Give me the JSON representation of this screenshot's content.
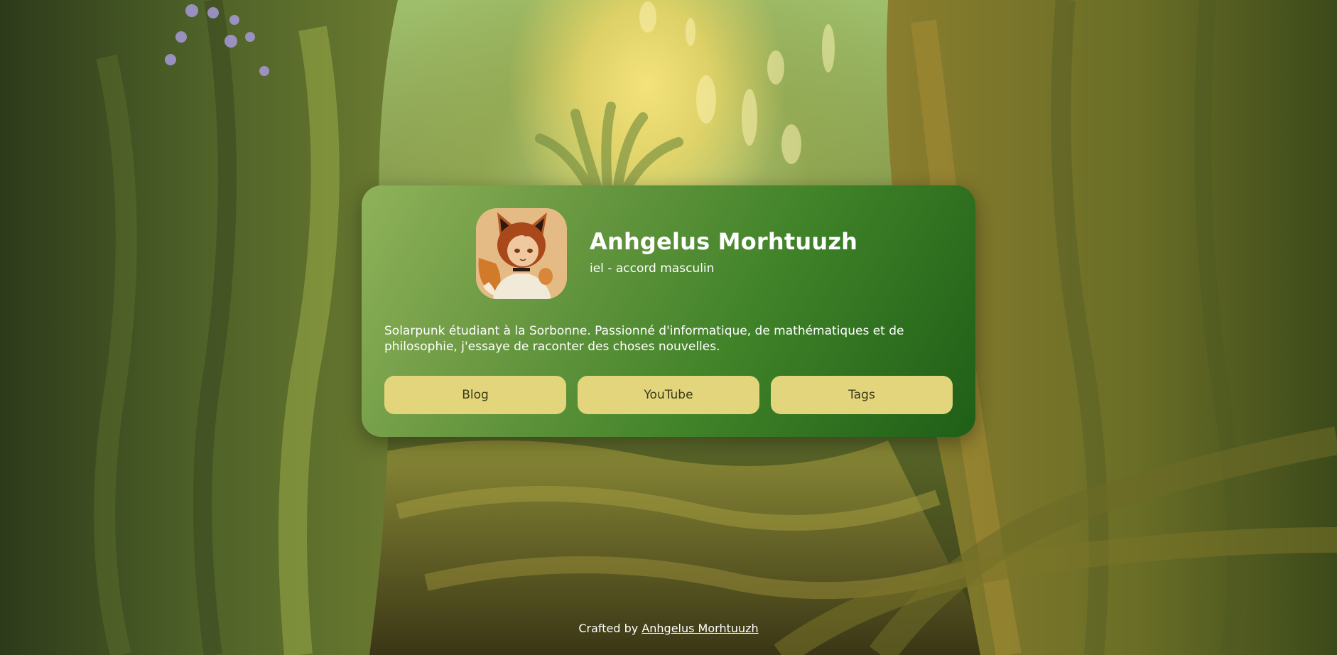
{
  "profile": {
    "name": "Anhgelus Morhtuuzh",
    "pronouns": "iel - accord masculin",
    "bio": "Solarpunk étudiant à la Sorbonne. Passionné d'informatique, de mathématiques et de philosophie, j'essaye de raconter des choses nouvelles."
  },
  "links": [
    {
      "label": "Blog"
    },
    {
      "label": "YouTube"
    },
    {
      "label": "Tags"
    }
  ],
  "footer": {
    "prefix": "Crafted by",
    "author_link": "Anhgelus Morhtuuzh"
  },
  "colors": {
    "button_bg": "#e2d57c",
    "card_gradient_start": "#8fb25a",
    "card_gradient_end": "#1f5e17",
    "text": "#ffffff"
  },
  "icons": {
    "avatar": "fox-character-avatar"
  }
}
